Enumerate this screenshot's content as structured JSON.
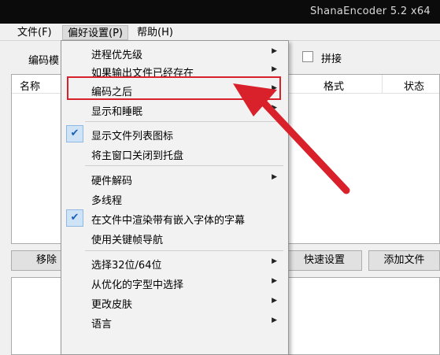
{
  "window": {
    "title": "ShanaEncoder 5.2 x64"
  },
  "menubar": {
    "items": [
      {
        "label": "文件(F)"
      },
      {
        "label": "偏好设置(P)"
      },
      {
        "label": "帮助(H)"
      }
    ]
  },
  "toolbar": {
    "label": "编码模",
    "merge_label": "拼接"
  },
  "list": {
    "columns": [
      {
        "label": "名称"
      },
      {
        "label": "格式"
      },
      {
        "label": "状态"
      }
    ]
  },
  "buttons": {
    "remove": "移除",
    "quick_settings": "快速设置",
    "add_file": "添加文件"
  },
  "dropdown": {
    "items": [
      {
        "label": "进程优先级",
        "submenu": true,
        "checked": false
      },
      {
        "label": "如果输出文件已经存在",
        "submenu": true,
        "checked": false
      },
      {
        "label": "编码之后",
        "submenu": true,
        "checked": false
      },
      {
        "label": "显示和睡眠",
        "submenu": true,
        "checked": false
      },
      {
        "label": "显示文件列表图标",
        "submenu": false,
        "checked": true
      },
      {
        "label": "将主窗口关闭到托盘",
        "submenu": false,
        "checked": false
      },
      {
        "label": "硬件解码",
        "submenu": true,
        "checked": false
      },
      {
        "label": "多线程",
        "submenu": false,
        "checked": false
      },
      {
        "label": "在文件中渲染带有嵌入字体的字幕",
        "submenu": false,
        "checked": true
      },
      {
        "label": "使用关键帧导航",
        "submenu": false,
        "checked": false
      },
      {
        "label": "选择32位/64位",
        "submenu": true,
        "checked": false
      },
      {
        "label": "从优化的字型中选择",
        "submenu": true,
        "checked": false
      },
      {
        "label": "更改皮肤",
        "submenu": true,
        "checked": false
      },
      {
        "label": "语言",
        "submenu": true,
        "checked": false
      }
    ]
  },
  "annotation": {
    "color": "#d8212a",
    "target": "编码之后"
  },
  "icons": {
    "check": "✔",
    "submenu_arrow": "▶"
  }
}
